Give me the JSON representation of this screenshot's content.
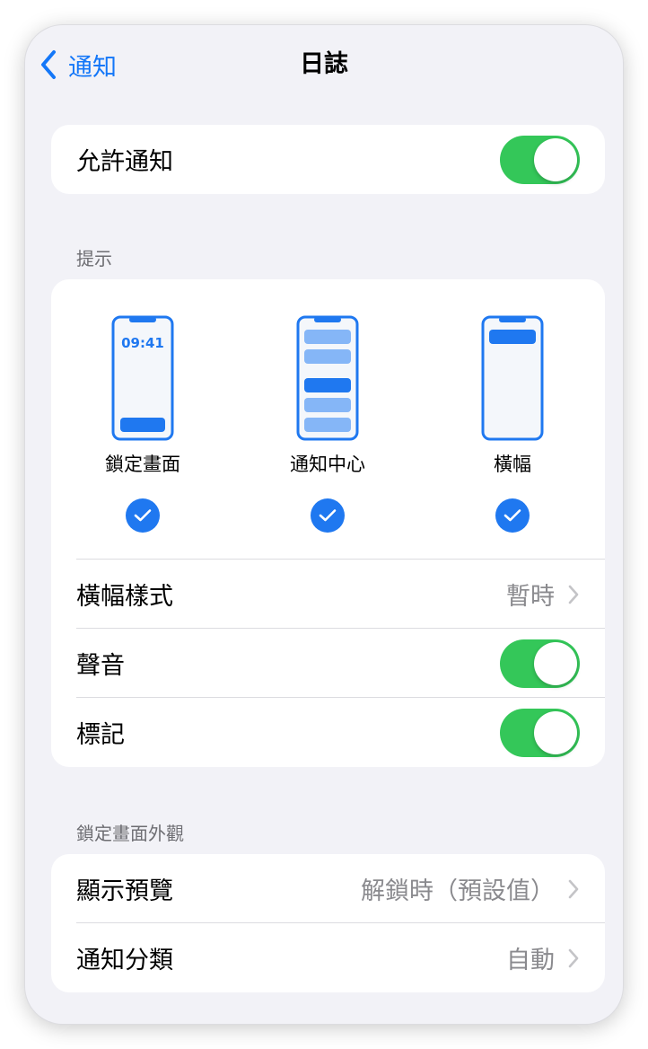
{
  "nav": {
    "back_label": "通知",
    "title": "日誌"
  },
  "allow": {
    "label": "允許通知",
    "on": true
  },
  "alerts": {
    "header": "提示",
    "styles": [
      {
        "label": "鎖定畫面",
        "time": "09:41",
        "checked": true
      },
      {
        "label": "通知中心",
        "checked": true
      },
      {
        "label": "橫幅",
        "checked": true
      }
    ],
    "banner_style": {
      "label": "橫幅樣式",
      "value": "暫時"
    },
    "sounds": {
      "label": "聲音",
      "on": true
    },
    "badges": {
      "label": "標記",
      "on": true
    }
  },
  "lock_screen": {
    "header": "鎖定畫面外觀",
    "show_previews": {
      "label": "顯示預覽",
      "value": "解鎖時（預設值）"
    },
    "grouping": {
      "label": "通知分類",
      "value": "自動"
    }
  },
  "colors": {
    "accent": "#1477f8",
    "toggle_on": "#34c759",
    "background": "#f2f2f7"
  }
}
